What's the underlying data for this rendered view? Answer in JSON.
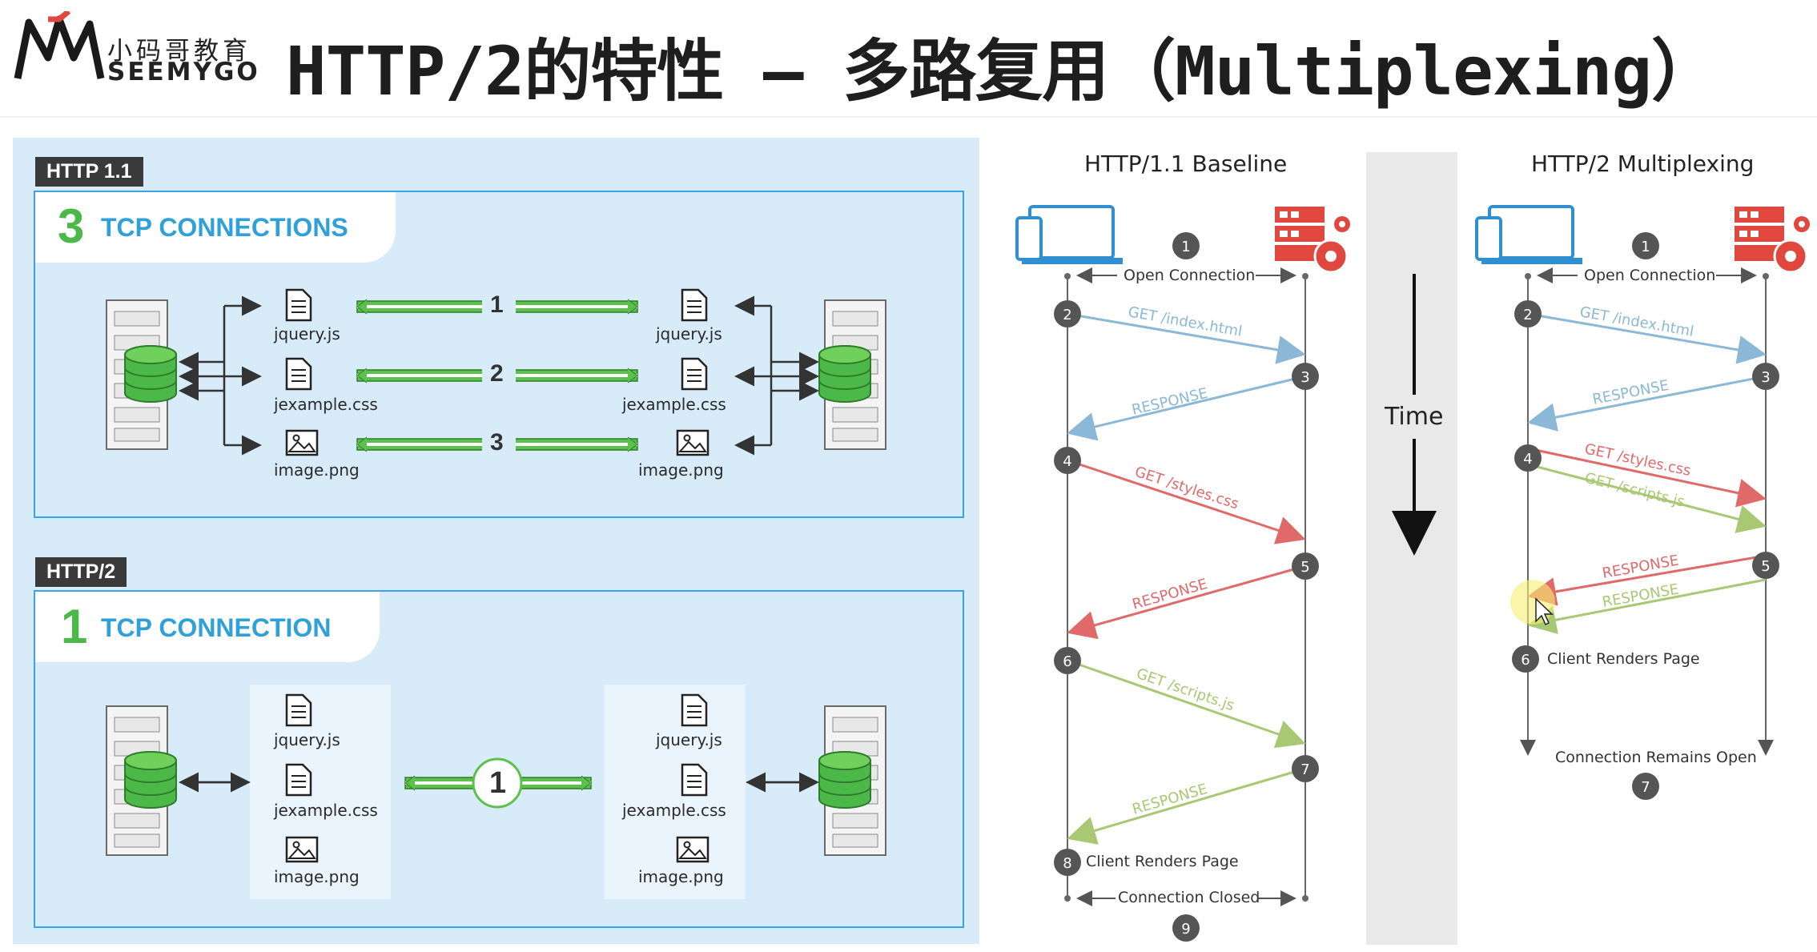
{
  "header": {
    "logo_cn": "小码哥教育",
    "logo_en": "SEEMYGO",
    "title": "HTTP/2的特性 – 多路复用（Multiplexing）"
  },
  "http11_panel": {
    "tag": "HTTP 1.1",
    "count": "3",
    "conn_label": "TCP CONNECTIONS",
    "files_left": [
      "jquery.js",
      "jexample.css",
      "image.png"
    ],
    "files_right": [
      "jquery.js",
      "jexample.css",
      "image.png"
    ],
    "lane_numbers": [
      "1",
      "2",
      "3"
    ]
  },
  "http2_panel": {
    "tag": "HTTP/2",
    "count": "1",
    "conn_label": "TCP CONNECTION",
    "files_left": [
      "jquery.js",
      "jexample.css",
      "image.png"
    ],
    "files_right": [
      "jquery.js",
      "jexample.css",
      "image.png"
    ],
    "lane_number": "1"
  },
  "baseline": {
    "title": "HTTP/1.1 Baseline",
    "steps": [
      "1",
      "2",
      "3",
      "4",
      "5",
      "6",
      "7",
      "8",
      "9"
    ],
    "open_connection": "Open Connection",
    "messages": [
      "GET /index.html",
      "RESPONSE",
      "GET /styles.css",
      "RESPONSE",
      "GET /scripts.js",
      "RESPONSE"
    ],
    "client_renders": "Client Renders Page",
    "connection_closed": "Connection Closed"
  },
  "time": {
    "label": "Time"
  },
  "multiplexing": {
    "title": "HTTP/2 Multiplexing",
    "steps": [
      "1",
      "2",
      "3",
      "4",
      "5",
      "6",
      "7"
    ],
    "open_connection": "Open Connection",
    "messages": [
      "GET /index.html",
      "RESPONSE",
      "GET /styles.css",
      "GET /scripts.js",
      "RESPONSE",
      "RESPONSE"
    ],
    "client_renders": "Client Renders Page",
    "connection_open": "Connection Remains Open"
  },
  "colors": {
    "accent_green": "#4bb849",
    "accent_blue": "#2fa0d8",
    "panel_bg": "#d8ebf9",
    "server_red": "#e0473f",
    "msg_blue": "#8ab8d6",
    "msg_red": "#e06a6a",
    "msg_green": "#a8c873"
  }
}
